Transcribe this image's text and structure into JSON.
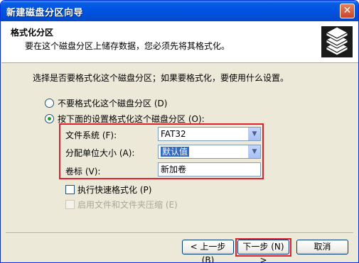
{
  "window": {
    "title": "新建磁盘分区向导",
    "close_glyph": "✕"
  },
  "header": {
    "title": "格式化分区",
    "subtitle": "要在这个磁盘分区上储存数据，您必须先将其格式化。",
    "icon": "disk-stack-icon"
  },
  "body": {
    "question": "选择是否要格式化这个磁盘分区；如果要格式化，要使用什么设置。",
    "options": [
      {
        "label": "不要格式化这个磁盘分区 (D)",
        "checked": false
      },
      {
        "label": "按下面的设置格式化这个磁盘分区 (O):",
        "checked": true
      }
    ],
    "fields": {
      "filesystem": {
        "label": "文件系统 (F):",
        "value": "FAT32"
      },
      "allocation": {
        "label": "分配单位大小 (A):",
        "value": "默认值"
      },
      "volume": {
        "label": "卷标 (V):",
        "value": "新加卷"
      }
    },
    "checks": [
      {
        "label": "执行快速格式化 (P)",
        "checked": false,
        "enabled": true
      },
      {
        "label": "启用文件和文件夹压缩 (E)",
        "checked": false,
        "enabled": false
      }
    ]
  },
  "buttons": {
    "back": "< 上一步 (B)",
    "next": "下一步 (N) >",
    "cancel": "取消"
  },
  "colors": {
    "titlebar": "#0054e3",
    "highlight": "#e0202a",
    "dialog": "#ece9d8"
  }
}
